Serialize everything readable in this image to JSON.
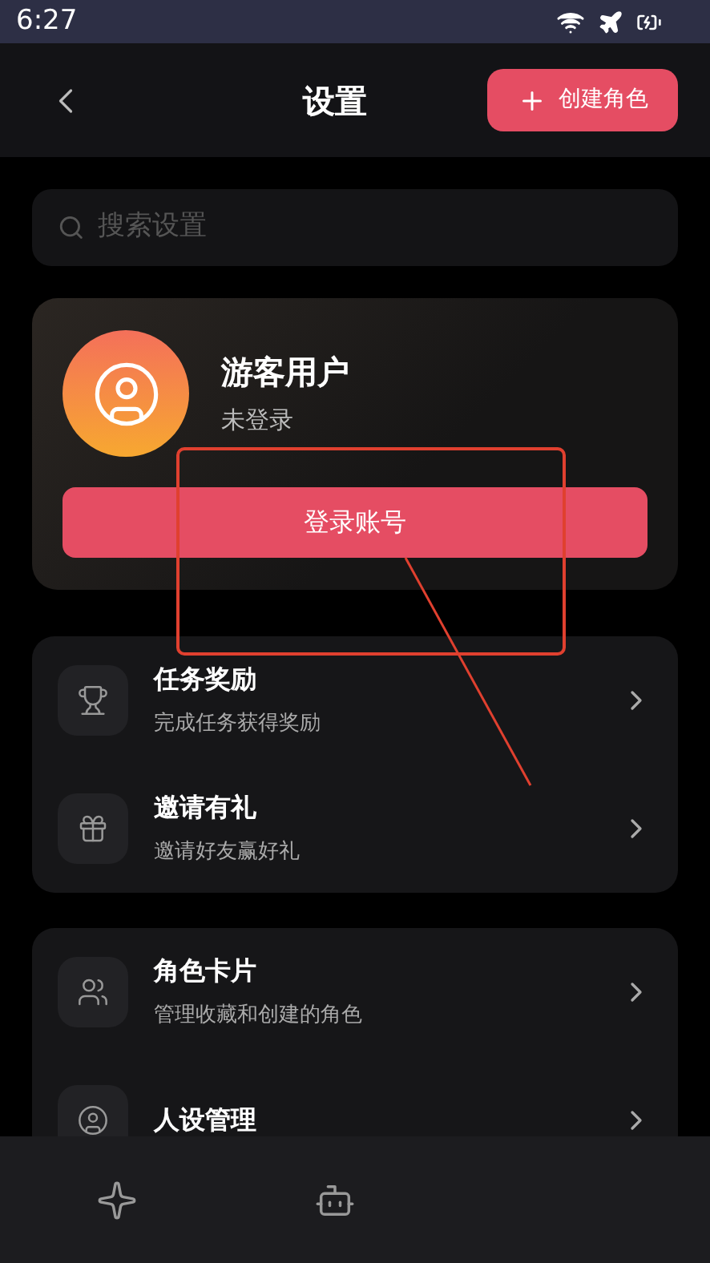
{
  "status_bar": {
    "time": "6:27"
  },
  "header": {
    "title": "设置",
    "create_button": "创建角色"
  },
  "search": {
    "placeholder": "搜索设置"
  },
  "profile": {
    "name": "游客用户",
    "status": "未登录",
    "login_button": "登录账号"
  },
  "groups": [
    {
      "items": [
        {
          "kind": "trophy",
          "title": "任务奖励",
          "subtitle": "完成任务获得奖励"
        },
        {
          "kind": "gift",
          "title": "邀请有礼",
          "subtitle": "邀请好友赢好礼"
        }
      ]
    },
    {
      "items": [
        {
          "kind": "people",
          "title": "角色卡片",
          "subtitle": "管理收藏和创建的角色"
        },
        {
          "kind": "persona",
          "title": "人设管理"
        }
      ]
    }
  ],
  "bottom_nav": [
    {
      "kind": "sparkle"
    },
    {
      "kind": "bot"
    }
  ]
}
